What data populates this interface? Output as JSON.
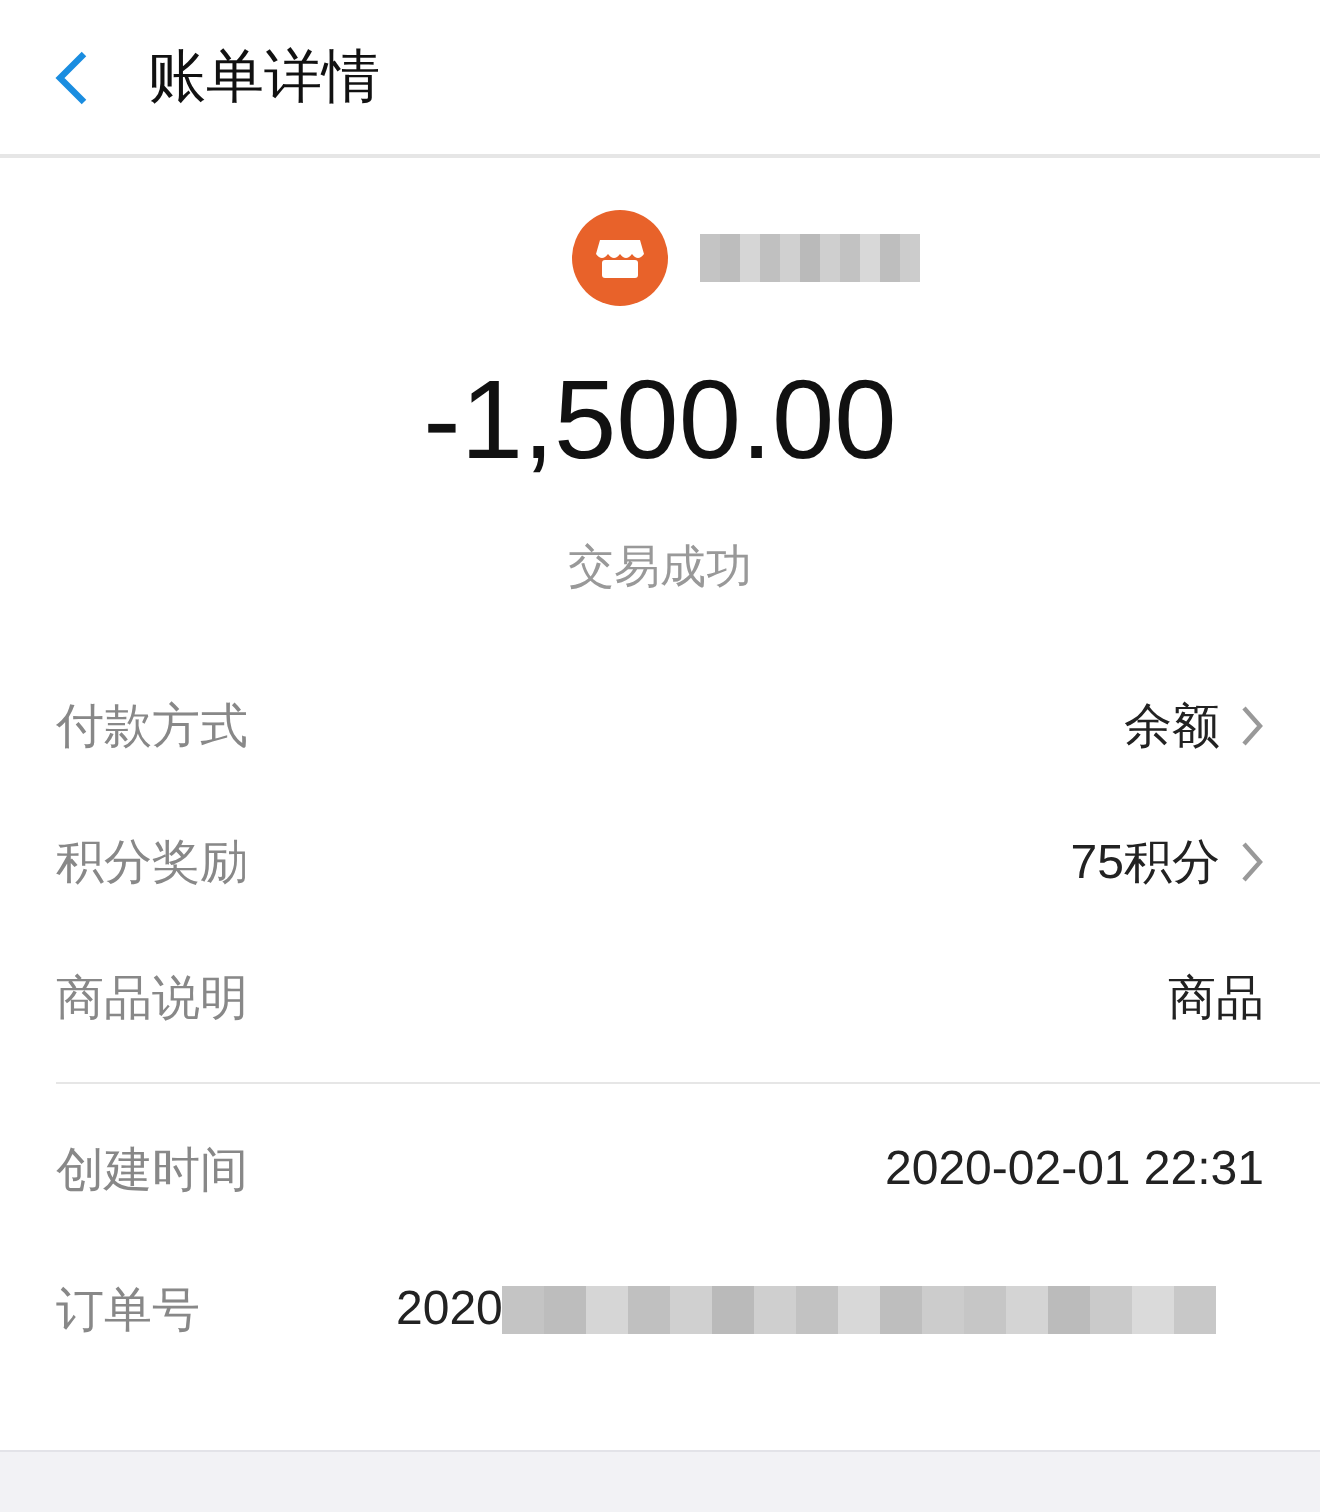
{
  "header": {
    "title": "账单详情"
  },
  "summary": {
    "amount": "-1,500.00",
    "status": "交易成功"
  },
  "payment_rows": [
    {
      "label": "付款方式",
      "value": "余额",
      "chevron": true
    },
    {
      "label": "积分奖励",
      "value": "75积分",
      "chevron": true
    },
    {
      "label": "商品说明",
      "value": "商品",
      "chevron": false
    }
  ],
  "info_rows": [
    {
      "label": "创建时间",
      "value": "2020-02-01 22:31",
      "masked": false
    },
    {
      "label": "订单号",
      "value": "2020",
      "masked": true
    }
  ]
}
